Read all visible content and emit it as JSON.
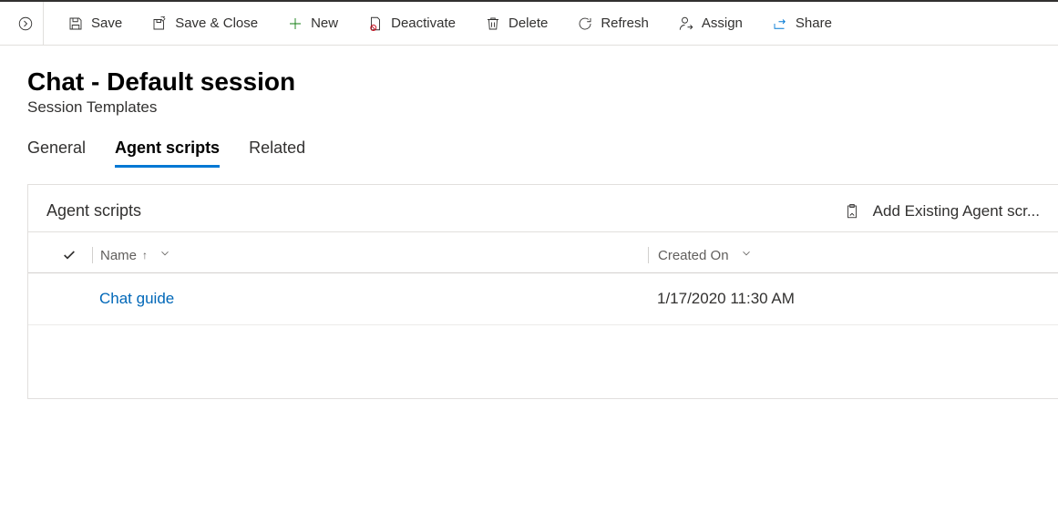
{
  "toolbar": {
    "save": "Save",
    "saveClose": "Save & Close",
    "new": "New",
    "deactivate": "Deactivate",
    "delete": "Delete",
    "refresh": "Refresh",
    "assign": "Assign",
    "share": "Share"
  },
  "header": {
    "title": "Chat - Default session",
    "subtitle": "Session Templates"
  },
  "tabs": {
    "general": "General",
    "agentScripts": "Agent scripts",
    "related": "Related"
  },
  "panel": {
    "title": "Agent scripts",
    "addExisting": "Add Existing Agent scr...",
    "columns": {
      "name": "Name",
      "created": "Created On"
    },
    "rows": [
      {
        "name": "Chat guide",
        "created": "1/17/2020 11:30 AM"
      }
    ]
  }
}
